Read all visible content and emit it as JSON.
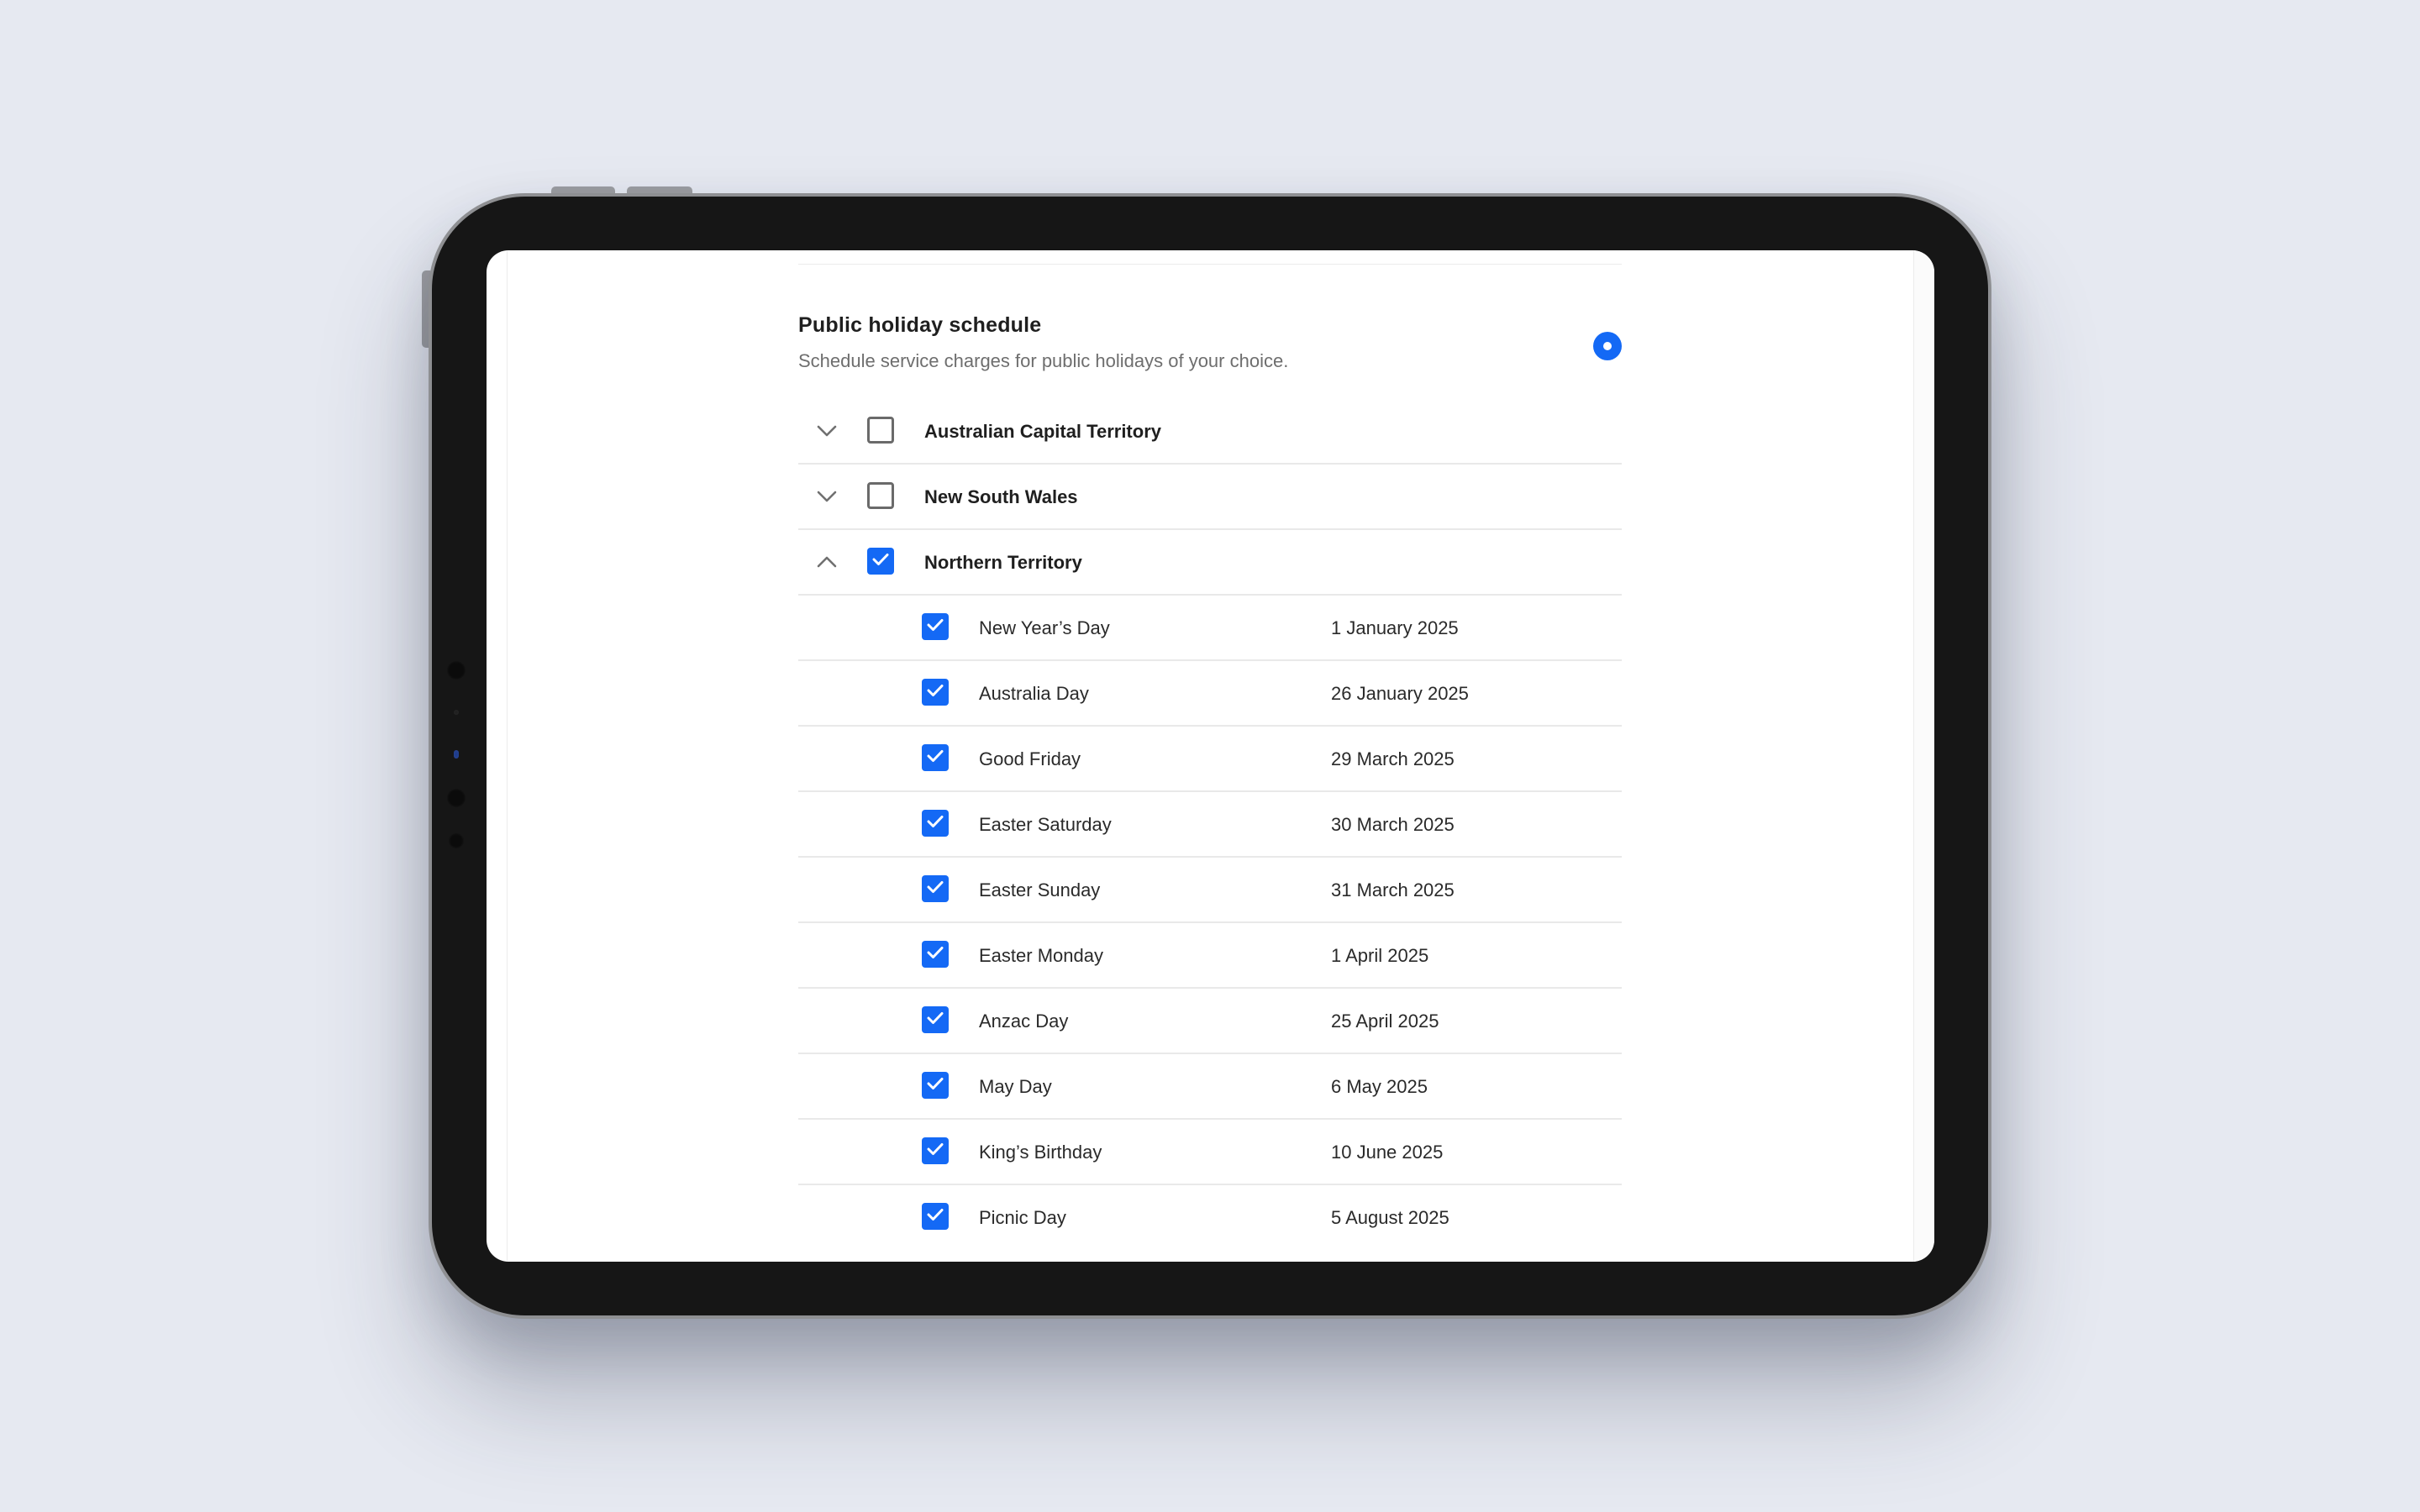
{
  "section": {
    "title": "Public holiday schedule",
    "subtitle": "Schedule service charges for public holidays of your choice.",
    "toggle_selected": true
  },
  "regions": [
    {
      "label": "Australian Capital Territory",
      "checked": false,
      "expanded": false
    },
    {
      "label": "New South Wales",
      "checked": false,
      "expanded": false
    },
    {
      "label": "Northern Territory",
      "checked": true,
      "expanded": true
    }
  ],
  "holidays": [
    {
      "name": "New Year’s Day",
      "date": "1 January 2025",
      "checked": true
    },
    {
      "name": "Australia Day",
      "date": "26 January 2025",
      "checked": true
    },
    {
      "name": "Good Friday",
      "date": "29 March 2025",
      "checked": true
    },
    {
      "name": "Easter Saturday",
      "date": "30 March 2025",
      "checked": true
    },
    {
      "name": "Easter Sunday",
      "date": "31 March 2025",
      "checked": true
    },
    {
      "name": "Easter Monday",
      "date": "1 April 2025",
      "checked": true
    },
    {
      "name": "Anzac Day",
      "date": "25 April 2025",
      "checked": true
    },
    {
      "name": "May Day",
      "date": "6 May 2025",
      "checked": true
    },
    {
      "name": "King’s Birthday",
      "date": "10 June 2025",
      "checked": true
    },
    {
      "name": "Picnic Day",
      "date": "5 August 2025",
      "checked": true
    }
  ],
  "icons": {
    "collapsed": "chevron-down-icon",
    "expanded": "chevron-up-icon",
    "check": "checkmark-icon"
  },
  "colors": {
    "accent": "#1469f5",
    "background": "#e6e9f1",
    "device_bezel": "#161616",
    "divider": "#e9e9e9"
  }
}
